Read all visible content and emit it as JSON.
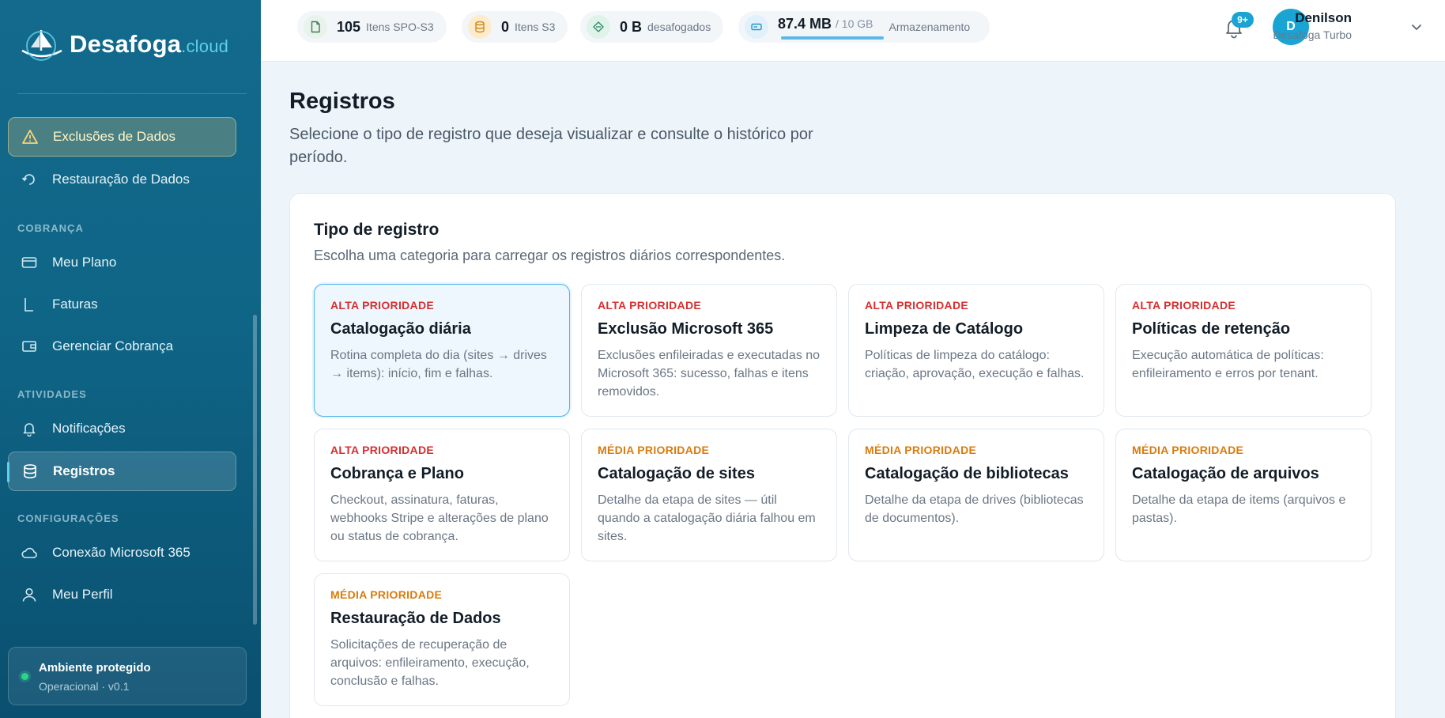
{
  "brand": {
    "name": "Desafoga",
    "suffix": ".cloud"
  },
  "sidebar": {
    "items_top": [
      {
        "label": "Exclusões de Dados",
        "icon": "warning-icon"
      },
      {
        "label": "Restauração de Dados",
        "icon": "restore-icon"
      }
    ],
    "section_billing": "COBRANÇA",
    "billing_items": [
      {
        "label": "Meu Plano",
        "icon": "card-icon"
      },
      {
        "label": "Faturas",
        "icon": "bookmark-icon"
      },
      {
        "label": "Gerenciar Cobrança",
        "icon": "wallet-icon"
      }
    ],
    "section_activities": "ATIVIDADES",
    "activity_items": [
      {
        "label": "Notificações",
        "icon": "bell-icon"
      },
      {
        "label": "Registros",
        "icon": "database-icon"
      }
    ],
    "section_settings": "CONFIGURAÇÕES",
    "settings_items": [
      {
        "label": "Conexão Microsoft 365",
        "icon": "cloud-icon"
      },
      {
        "label": "Meu Perfil",
        "icon": "user-icon"
      }
    ],
    "status": {
      "title": "Ambiente protegido",
      "subtitle": "Operacional · v0.1"
    }
  },
  "topbar": {
    "stats": [
      {
        "value": "105",
        "label": "Itens SPO-S3",
        "icon": "file-icon",
        "color": "#e8f3ec"
      },
      {
        "value": "0",
        "label": "Itens S3",
        "icon": "database-icon",
        "color": "#fdeccc"
      },
      {
        "value": "0 B",
        "label": "desafogados",
        "icon": "leaf-icon",
        "color": "#dff3ea"
      }
    ],
    "storage": {
      "value": "87.4 MB",
      "total": "/ 10 GB",
      "label": "Armazenamento",
      "fraction": 0.009
    },
    "notifications_badge": "9+",
    "user": {
      "initial": "D",
      "name": "Denilson",
      "plan": "Desafoga Turbo"
    }
  },
  "page": {
    "title": "Registros",
    "description": "Selecione o tipo de registro que deseja visualizar e consulte o histórico por período."
  },
  "panel": {
    "title": "Tipo de registro",
    "description": "Escolha uma categoria para carregar os registros diários correspondentes.",
    "cards": [
      {
        "priority": "ALTA PRIORIDADE",
        "level": "alta",
        "title": "Catalogação diária",
        "desc": "Rotina completa do dia (sites → drives → items): início, fim e falhas.",
        "selected": true
      },
      {
        "priority": "ALTA PRIORIDADE",
        "level": "alta",
        "title": "Exclusão Microsoft 365",
        "desc": "Exclusões enfileiradas e executadas no Microsoft 365: sucesso, falhas e itens removidos."
      },
      {
        "priority": "ALTA PRIORIDADE",
        "level": "alta",
        "title": "Limpeza de Catálogo",
        "desc": "Políticas de limpeza do catálogo: criação, aprovação, execução e falhas."
      },
      {
        "priority": "ALTA PRIORIDADE",
        "level": "alta",
        "title": "Políticas de retenção",
        "desc": "Execução automática de políticas: enfileiramento e erros por tenant."
      },
      {
        "priority": "ALTA PRIORIDADE",
        "level": "alta",
        "title": "Cobrança e Plano",
        "desc": "Checkout, assinatura, faturas, webhooks Stripe e alterações de plano ou status de cobrança."
      },
      {
        "priority": "MÉDIA PRIORIDADE",
        "level": "media",
        "title": "Catalogação de sites",
        "desc": "Detalhe da etapa de sites — útil quando a catalogação diária falhou em sites."
      },
      {
        "priority": "MÉDIA PRIORIDADE",
        "level": "media",
        "title": "Catalogação de bibliotecas",
        "desc": "Detalhe da etapa de drives (bibliotecas de documentos)."
      },
      {
        "priority": "MÉDIA PRIORIDADE",
        "level": "media",
        "title": "Catalogação de arquivos",
        "desc": "Detalhe da etapa de items (arquivos e pastas)."
      },
      {
        "priority": "MÉDIA PRIORIDADE",
        "level": "media",
        "title": "Restauração de Dados",
        "desc": "Solicitações de recuperação de arquivos: enfileiramento, execução, conclusão e falhas."
      }
    ]
  }
}
